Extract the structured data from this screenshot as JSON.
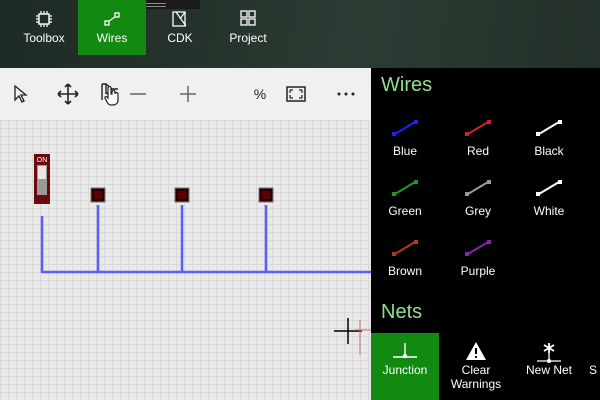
{
  "nav": {
    "items": [
      {
        "label": "Toolbox",
        "icon": "chip-icon"
      },
      {
        "label": "Wires",
        "icon": "wire-icon"
      },
      {
        "label": "CDK",
        "icon": "cdk-icon"
      },
      {
        "label": "Project",
        "icon": "grid-icon"
      }
    ],
    "active": "Wires",
    "accent": "#128a12"
  },
  "toolbar": {
    "zoom_label": "%"
  },
  "canvas": {
    "switch_label": "ON",
    "wire_color": "#5a5aff"
  },
  "panel": {
    "wires_title": "Wires",
    "wires": [
      {
        "label": "Blue",
        "color": "#1f1fff"
      },
      {
        "label": "Red",
        "color": "#d81f1f"
      },
      {
        "label": "Black",
        "color": "#ffffff"
      },
      {
        "label": "Green",
        "color": "#1f9a1f"
      },
      {
        "label": "Grey",
        "color": "#9a9a9a"
      },
      {
        "label": "White",
        "color": "#ffffff"
      },
      {
        "label": "Brown",
        "color": "#b23a1f"
      },
      {
        "label": "Purple",
        "color": "#8a1fb2"
      }
    ],
    "nets_title": "Nets",
    "nets": [
      {
        "label": "Junction",
        "icon": "junction-icon"
      },
      {
        "label": "Clear Warnings",
        "icon": "warning-icon"
      },
      {
        "label": "New Net",
        "icon": "new-net-icon"
      },
      {
        "label": "S",
        "icon": ""
      }
    ],
    "title_color": "#8fe08f"
  }
}
